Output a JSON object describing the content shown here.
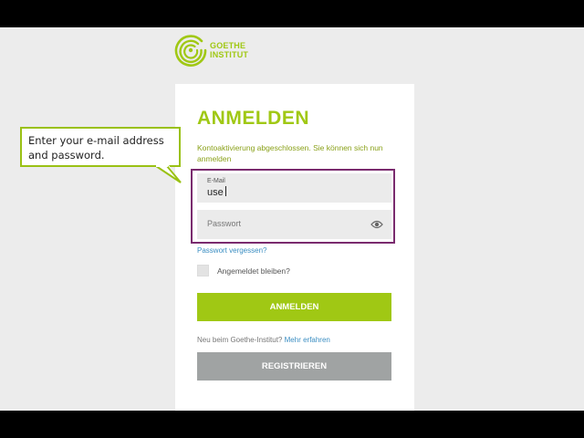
{
  "logo": {
    "line1": "GOETHE",
    "line2": "INSTITUT",
    "icon": "goethe-rings-icon"
  },
  "login": {
    "title": "ANMELDEN",
    "info": "Kontoaktivierung abgeschlossen. Sie können sich nun anmelden",
    "email_label": "E-Mail",
    "email_value": "use",
    "password_placeholder": "Passwort",
    "forgot": "Passwort vergessen?",
    "remember": "Angemeldet bleiben?",
    "submit": "ANMELDEN",
    "new_prefix": "Neu beim Goethe-Institut?",
    "new_link": "Mehr erfahren",
    "register": "REGISTRIEREN"
  },
  "tooltip": {
    "line1": "Enter your e-mail address",
    "line2": "and password."
  },
  "colors": {
    "brand_green": "#a0c814",
    "focus_frame": "#7a2b6e",
    "link_blue": "#3b8ec2",
    "register_grey": "#a0a3a3"
  }
}
